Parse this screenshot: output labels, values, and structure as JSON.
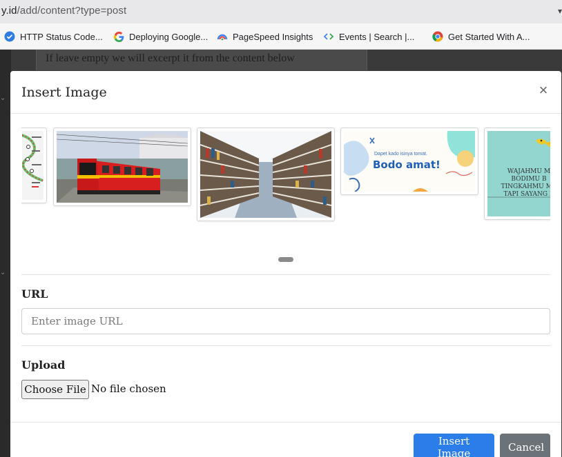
{
  "browser": {
    "url_host": "y.id",
    "url_path": "/add/content?type=post",
    "bookmarks": [
      {
        "label": "HTTP Status Code...",
        "icon": "http-status-icon"
      },
      {
        "label": "Deploying Google...",
        "icon": "google-icon"
      },
      {
        "label": "PageSpeed Insights",
        "icon": "pagespeed-icon"
      },
      {
        "label": "Events  |  Search  |...",
        "icon": "events-icon"
      },
      {
        "label": "Get Started With A...",
        "icon": "chrome-icon"
      }
    ]
  },
  "background_page": {
    "hint": "If leave empty we will excerpt it from the content below"
  },
  "modal": {
    "title": "Insert Image",
    "close_label": "×",
    "gallery": {
      "meme_text": "Dapet kado isinya tomat.",
      "meme_title": "Bodo amat!",
      "quote_lines": [
        "WAJAHMU M",
        "BODIMU B",
        "TINGKAHMU ME",
        "TAPI SAYANG E"
      ]
    },
    "url_section": {
      "label": "URL",
      "placeholder": "Enter image URL",
      "value": ""
    },
    "upload_section": {
      "label": "Upload",
      "button_label": "Choose File",
      "status": "No file chosen"
    },
    "insert_label": "Insert Image",
    "cancel_label": "Cancel"
  },
  "colors": {
    "primary": "#2b7de9",
    "secondary": "#6b7278"
  }
}
